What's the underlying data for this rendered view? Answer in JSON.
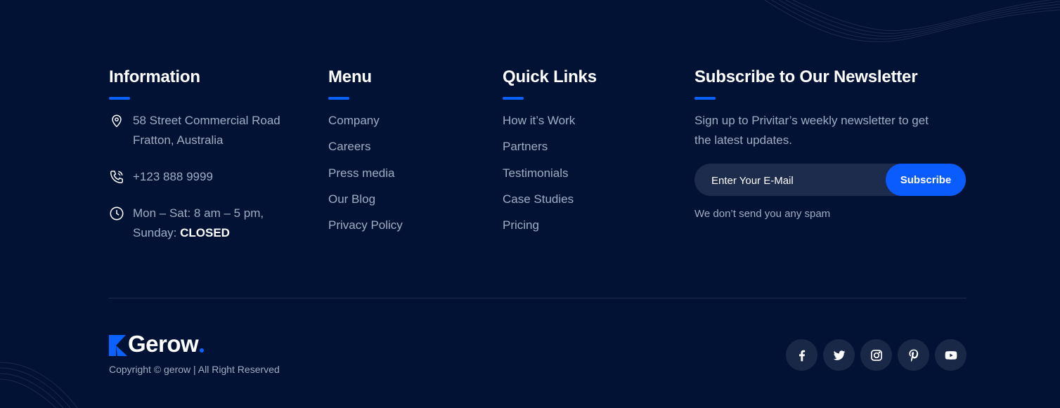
{
  "information": {
    "heading": "Information",
    "address_line1": "58 Street Commercial Road",
    "address_line2": "Fratton, Australia",
    "phone": "+123 888 9999",
    "hours_line1": "Mon – Sat: 8 am – 5 pm,",
    "hours_line2_prefix": "Sunday: ",
    "hours_line2_closed": "CLOSED"
  },
  "menu": {
    "heading": "Menu",
    "items": [
      "Company",
      "Careers",
      "Press media",
      "Our Blog",
      "Privacy Policy"
    ]
  },
  "quick_links": {
    "heading": "Quick Links",
    "items": [
      "How it’s Work",
      "Partners",
      "Testimonials",
      "Case Studies",
      "Pricing"
    ]
  },
  "newsletter": {
    "heading": "Subscribe to Our Newsletter",
    "description": "Sign up to Privitar’s weekly newsletter to get the latest updates.",
    "email_placeholder": "Enter Your E-Mail",
    "email_value": "",
    "button_label": "Subscribe",
    "note": "We don’t send you any spam"
  },
  "brand": {
    "logo_text": "Gerow",
    "copyright": "Copyright © gerow | All Right Reserved"
  },
  "socials": [
    {
      "icon": "facebook-icon"
    },
    {
      "icon": "twitter-icon"
    },
    {
      "icon": "instagram-icon"
    },
    {
      "icon": "pinterest-icon"
    },
    {
      "icon": "youtube-icon"
    }
  ],
  "colors": {
    "background": "#021234",
    "accent": "#0b63ff",
    "muted_text": "#a2adc4",
    "input_bg": "#1d2b4d",
    "social_bg": "#1a2848"
  }
}
